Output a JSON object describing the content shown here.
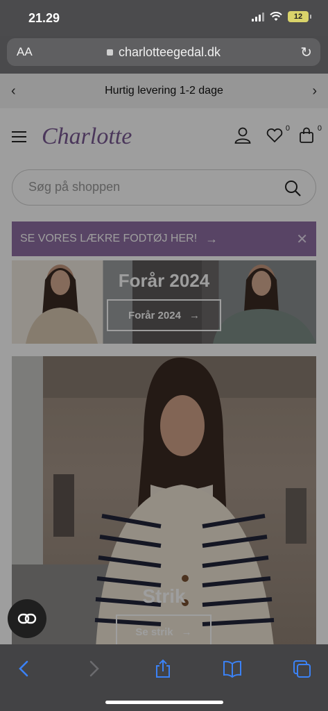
{
  "status_bar": {
    "time": "21.29",
    "battery": "12"
  },
  "browser": {
    "aa_label": "AA",
    "url": "charlotteegedal.dk"
  },
  "announcement": {
    "text": "Hurtig levering 1-2 dage"
  },
  "header": {
    "logo": "Charlotte",
    "wishlist_count": "0",
    "cart_count": "0"
  },
  "search": {
    "placeholder": "Søg på shoppen"
  },
  "promo": {
    "text": "SE VORES LÆKRE FODTØJ HER!"
  },
  "banner": {
    "title": "Forår 2024",
    "button_label": "Forår 2024"
  },
  "hero": {
    "title": "Strik",
    "button_label": "Se strik"
  },
  "colors": {
    "brand_purple": "#8f6fa3",
    "logo_purple": "#7a5a93",
    "safari_blue": "#3b82f6"
  }
}
